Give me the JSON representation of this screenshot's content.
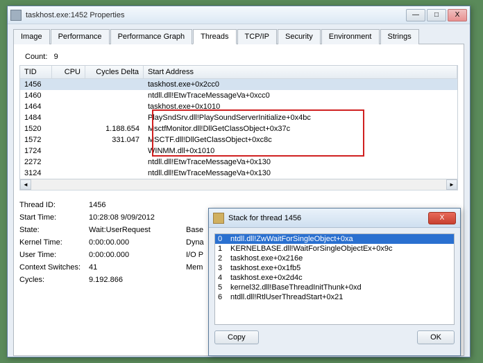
{
  "main_window": {
    "title": "taskhost.exe:1452 Properties",
    "sysmenu": {
      "minimize": "—",
      "maximize": "□",
      "close": "X"
    }
  },
  "tabs": [
    "Image",
    "Performance",
    "Performance Graph",
    "Threads",
    "TCP/IP",
    "Security",
    "Environment",
    "Strings"
  ],
  "active_tab_index": 3,
  "threads": {
    "count_label": "Count:",
    "count_value": "9",
    "columns": {
      "tid": "TID",
      "cpu": "CPU",
      "cycles": "Cycles Delta",
      "addr": "Start Address"
    },
    "rows": [
      {
        "tid": "1456",
        "cpu": "",
        "cycles": "",
        "addr": "taskhost.exe+0x2cc0",
        "sel": true
      },
      {
        "tid": "1460",
        "cpu": "",
        "cycles": "",
        "addr": "ntdll.dll!EtwTraceMessageVa+0xcc0"
      },
      {
        "tid": "1464",
        "cpu": "",
        "cycles": "",
        "addr": "taskhost.exe+0x1010"
      },
      {
        "tid": "1484",
        "cpu": "",
        "cycles": "",
        "addr": "PlaySndSrv.dll!PlaySoundServerInitialize+0x4bc"
      },
      {
        "tid": "1520",
        "cpu": "",
        "cycles": "1.188.654",
        "addr": "MsctfMonitor.dll!DllGetClassObject+0x37c"
      },
      {
        "tid": "1572",
        "cpu": "",
        "cycles": "331.047",
        "addr": "MSCTF.dll!DllGetClassObject+0xc8c"
      },
      {
        "tid": "1724",
        "cpu": "",
        "cycles": "",
        "addr": "WINMM.dll+0x1010"
      },
      {
        "tid": "2272",
        "cpu": "",
        "cycles": "",
        "addr": "ntdll.dll!EtwTraceMessageVa+0x130"
      },
      {
        "tid": "3124",
        "cpu": "",
        "cycles": "",
        "addr": "ntdll.dll!EtwTraceMessageVa+0x130"
      }
    ]
  },
  "details": {
    "thread_id": {
      "label": "Thread ID:",
      "value": "1456"
    },
    "start_time": {
      "label": "Start Time:",
      "value": "10:28:08  9/09/2012"
    },
    "state": {
      "label": "State:",
      "value": "Wait:UserRequest",
      "extra": "Base"
    },
    "kernel_time": {
      "label": "Kernel Time:",
      "value": "0:00:00.000",
      "extra": "Dyna"
    },
    "user_time": {
      "label": "User Time:",
      "value": "0:00:00.000",
      "extra": "I/O P"
    },
    "context_switches": {
      "label": "Context Switches:",
      "value": "41",
      "extra": "Mem"
    },
    "cycles": {
      "label": "Cycles:",
      "value": "9.192.866"
    }
  },
  "stack_window": {
    "title": "Stack for thread 1456",
    "close": "X",
    "rows": [
      {
        "n": "0",
        "text": "ntdll.dll!ZwWaitForSingleObject+0xa",
        "sel": true
      },
      {
        "n": "1",
        "text": "KERNELBASE.dll!WaitForSingleObjectEx+0x9c"
      },
      {
        "n": "2",
        "text": "taskhost.exe+0x216e"
      },
      {
        "n": "3",
        "text": "taskhost.exe+0x1fb5"
      },
      {
        "n": "4",
        "text": "taskhost.exe+0x2d4c"
      },
      {
        "n": "5",
        "text": "kernel32.dll!BaseThreadInitThunk+0xd"
      },
      {
        "n": "6",
        "text": "ntdll.dll!RtlUserThreadStart+0x21"
      }
    ],
    "copy_btn": "Copy",
    "ok_btn": "OK"
  }
}
